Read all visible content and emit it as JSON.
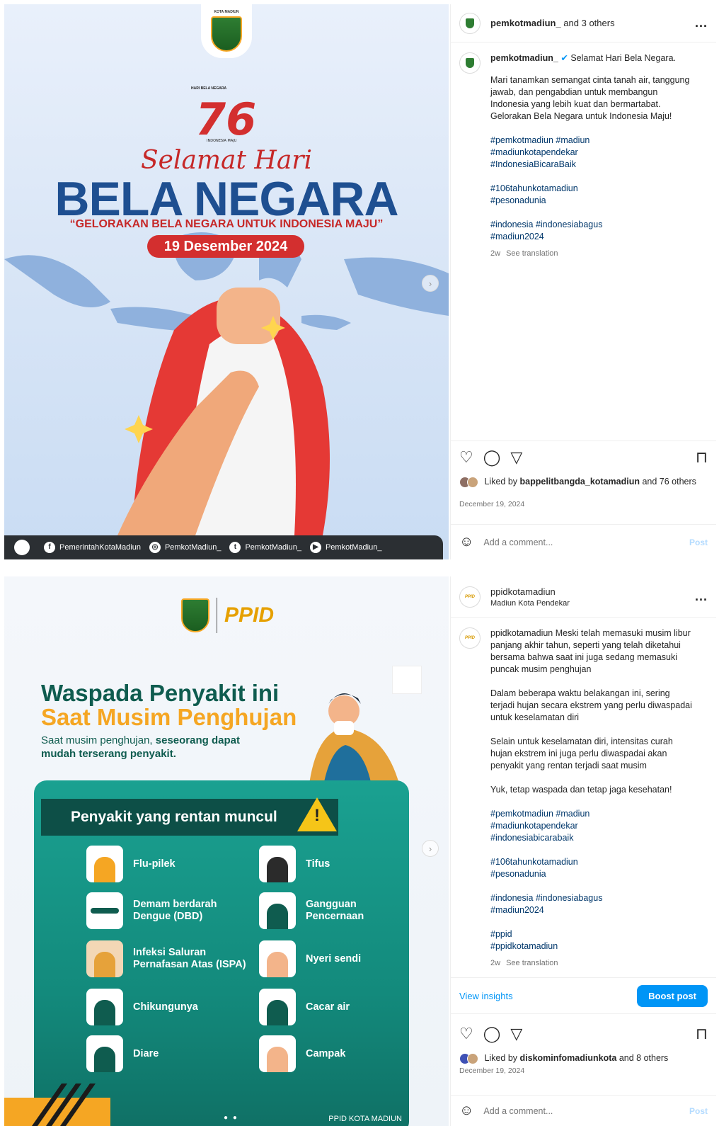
{
  "post1": {
    "header": {
      "username": "pemkotmadiun_",
      "collab": " and 3 others",
      "more": "..."
    },
    "caption": {
      "username": "pemkotmadiun_",
      "title": "Selamat Hari Bela Negara.",
      "paragraph": "Mari tanamkan semangat cinta tanah air, tanggung jawab, dan pengabdian untuk membangun Indonesia yang lebih kuat dan bermartabat. Gelorakan Bela Negara untuk Indonesia Maju!",
      "tags1": [
        "#pemkotmadiun #madiun",
        "#madiunkotapendekar",
        "#IndonesiaBicaraBaik"
      ],
      "tags2": [
        "#106tahunkotamadiun",
        "#pesonadunia"
      ],
      "tags3": [
        "#indonesia #indonesiabagus",
        "#madiun2024"
      ],
      "age": "2w",
      "see_translation": "See translation"
    },
    "likes": {
      "prefix": "Liked by ",
      "user": "bappelitbangda_kotamadiun",
      "suffix": " and 76 others"
    },
    "date": "December 19, 2024",
    "comment": {
      "placeholder": "Add a comment...",
      "post": "Post"
    },
    "media": {
      "crest_label": "KOTA MADIUN",
      "hbn_label": "HARI BELA NEGARA",
      "logo_number": "76",
      "logo_sub": "INDONESIA MAJU",
      "script": "Selamat Hari",
      "headline": "BELA NEGARA",
      "slogan": "“GELORAKAN BELA NEGARA UNTUK INDONESIA MAJU”",
      "date_pill": "19 Desember 2024",
      "socials": [
        "PemerintahKotaMadiun",
        "PemkotMadiun_",
        "PemkotMadiun_",
        "PemkotMadiun_"
      ]
    }
  },
  "post2": {
    "header": {
      "username": "ppidkotamadiun",
      "subtitle": "Madiun Kota Pendekar",
      "more": "..."
    },
    "caption": {
      "username": "ppidkotamadiun",
      "p1": "Meski telah memasuki musim libur panjang akhir tahun, seperti yang telah diketahui bersama bahwa saat ini juga sedang memasuki puncak musim penghujan",
      "p2": "Dalam beberapa waktu belakangan ini, sering terjadi hujan secara ekstrem yang perlu diwaspadai untuk keselamatan diri",
      "p3": "Selain untuk keselamatan diri, intensitas curah hujan ekstrem ini juga perlu diwaspadai akan penyakit yang rentan terjadi saat musim",
      "p4": "Yuk, tetap waspada dan tetap jaga kesehatan!",
      "tags1": [
        "#pemkotmadiun #madiun",
        "#madiunkotapendekar",
        "#indonesiabicarabaik"
      ],
      "tags2": [
        "#106tahunkotamadiun",
        "#pesonadunia"
      ],
      "tags3": [
        "#indonesia #indonesiabagus",
        "#madiun2024"
      ],
      "tags4": [
        "#ppid",
        "#ppidkotamadiun"
      ],
      "age": "2w",
      "see_translation": "See translation"
    },
    "insights": {
      "view": "View insights",
      "boost": "Boost post"
    },
    "likes": {
      "prefix": "Liked by ",
      "user": "diskominfomadiunkota",
      "suffix": " and 8 others"
    },
    "date": "December 19, 2024",
    "comment": {
      "placeholder": "Add a comment...",
      "post": "Post"
    },
    "media": {
      "ppid_logo": "PPID",
      "title1": "Waspada Penyakit ini",
      "title2": "Saat Musim Penghujan",
      "subtitle_a": "Saat musim penghujan, ",
      "subtitle_b": "seseorang dapat mudah terserang penyakit.",
      "bar_title": "Penyakit yang rentan muncul",
      "diseases_left": [
        "Flu-pilek",
        "Demam berdarah Dengue (DBD)",
        "Infeksi Saluran Pernafasan Atas (ISPA)",
        "Chikungunya",
        "Diare"
      ],
      "diseases_right": [
        "Tifus",
        "Gangguan Pencernaan",
        "Nyeri sendi",
        "Cacar air",
        "Campak"
      ],
      "footer": "PPID KOTA MADIUN"
    }
  },
  "icons": {
    "heart": "♡",
    "comment": "◯",
    "share": "▽",
    "bookmark": "⊓",
    "smile": "☺",
    "next": "›"
  }
}
